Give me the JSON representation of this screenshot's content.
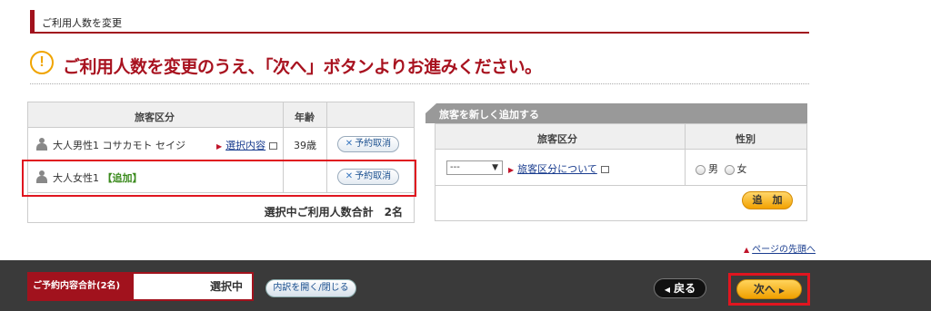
{
  "section": {
    "title": "ご利用人数を変更"
  },
  "notice": {
    "icon": "exclamation-icon",
    "message": "ご利用人数を変更のうえ、「次へ」ボタンよりお進みください。"
  },
  "passengers": {
    "headers": {
      "category": "旅客区分",
      "age": "年齢"
    },
    "rows": [
      {
        "name": "大人男性1 コサカモト セイジ",
        "tag": "",
        "link": "選択内容",
        "age": "39歳",
        "cancel": "予約取消"
      },
      {
        "name": "大人女性1 ",
        "tag": "【追加】",
        "link": "",
        "age": "",
        "cancel": "予約取消"
      }
    ],
    "summary": "選択中ご利用人数合計　2名"
  },
  "add_panel": {
    "title": "旅客を新しく追加する",
    "headers": {
      "category": "旅客区分",
      "gender": "性別"
    },
    "select_value": "---",
    "link": "旅客区分について",
    "gender_male": "男",
    "gender_female": "女",
    "add_button": "追　加"
  },
  "page_top": "ページの先頭へ",
  "footer": {
    "total_label": "ご予約内容合計(2名)",
    "total_value": "選択中",
    "toggle_button": "内訳を開く/閉じる",
    "back_button": "戻る",
    "next_button": "次へ"
  }
}
